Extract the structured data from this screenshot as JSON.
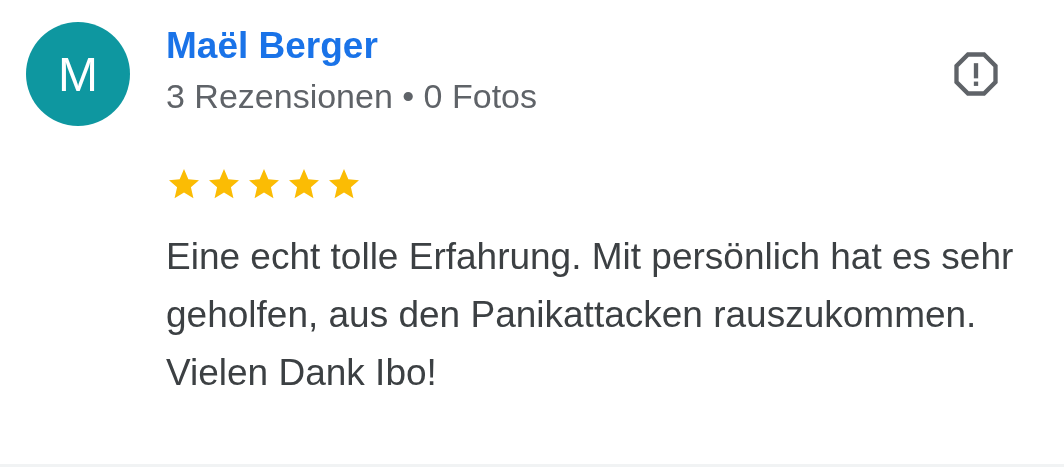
{
  "review": {
    "avatar_letter": "M",
    "name": "Maël Berger",
    "meta": "3 Rezensionen • 0 Fotos",
    "stars": 5,
    "text": "Eine echt tolle Erfahrung. Mit persönlich hat es sehr geholfen, aus den Panikattacken rauszukommen. Vielen Dank Ibo!"
  }
}
